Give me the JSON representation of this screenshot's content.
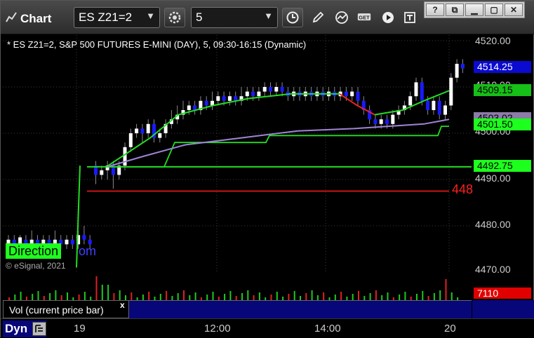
{
  "toolbar": {
    "title": "Chart",
    "symbol": "ES Z21=2",
    "interval": "5",
    "icons": [
      "chart-icon",
      "settings-icon",
      "clock-icon",
      "pencil-icon",
      "indicator-icon",
      "get-icon",
      "play-icon",
      "template-icon"
    ],
    "window_controls": [
      "?",
      "restore",
      "minimize",
      "maximize",
      "close"
    ]
  },
  "chart": {
    "description": "* ES Z21=2, S&P 500 FUTURES E-MINI (DAY), 5, 09:30-16:15 (Dynamic)",
    "copyright": "© eSignal, 2021",
    "direction_label": "Direction",
    "direction_suffix": "om",
    "red_line_label": "448"
  },
  "price_axis": {
    "ticks": [
      "4520.00",
      "4510.00",
      "4500.00",
      "4490.00",
      "4480.00",
      "4470.00"
    ],
    "tags": [
      {
        "label": "4514.25",
        "bg": "#0a0ad0",
        "fg": "#ffffff"
      },
      {
        "label": "4509.15",
        "bg": "#16c016",
        "fg": "#000000"
      },
      {
        "label": "4503.02",
        "bg": "#8c7ca8",
        "fg": "#000000"
      },
      {
        "label": "4501.50",
        "bg": "#1dff1d",
        "fg": "#000000"
      },
      {
        "label": "4492.75",
        "bg": "#1dff1d",
        "fg": "#000000"
      }
    ]
  },
  "volume": {
    "label": "Vol (current price bar)",
    "close_glyph": "x",
    "current": "7110"
  },
  "time_axis": {
    "mode": "Dyn",
    "ticks": [
      "19",
      "12:00",
      "14:00",
      "20"
    ]
  },
  "colors": {
    "up_candle": "#ffffff",
    "down_candle": "#1a1aff",
    "green_ma": "#22dd22",
    "red_ma": "#ee2222",
    "purple_ma": "#9f84d6",
    "grid": "#3a3a3a",
    "red_line": "#ff1a1a"
  }
}
